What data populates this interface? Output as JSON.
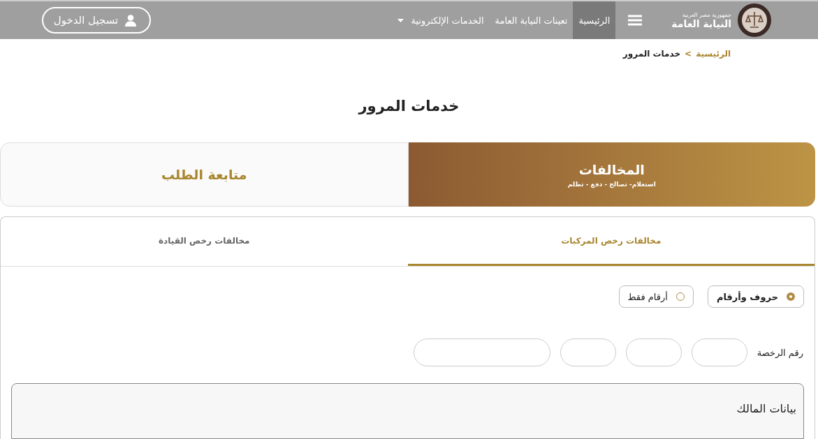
{
  "header": {
    "logo_caption": "جمهورية مصر العربية",
    "logo_title": "النيابة العامة",
    "nav": [
      {
        "label": "الرئيسية",
        "selected": true,
        "dropdown": false
      },
      {
        "label": "تعينات النيابة العامة",
        "selected": false,
        "dropdown": false
      },
      {
        "label": "الخدمات الإلكترونية",
        "selected": false,
        "dropdown": true
      }
    ],
    "login": "تسجيل الدخول"
  },
  "breadcrumb": {
    "items": [
      "الرئيسية",
      ">"
    ],
    "current": "خدمات المرور"
  },
  "page_title": "خدمات المرور",
  "main_tabs": [
    {
      "title": "المخالفات",
      "subtitle": "استعلام- تصالح - دفع - تظلم",
      "selected": true
    },
    {
      "title": "متابعة الطلب",
      "selected": false
    }
  ],
  "sub_tabs": [
    {
      "label": "مخالفات رخص المركبات",
      "selected": true
    },
    {
      "label": "مخالفات رخص القيادة",
      "selected": false
    }
  ],
  "radios": [
    {
      "label": "حروف وأرقام",
      "selected": true
    },
    {
      "label": "أرقام فقط",
      "selected": false
    }
  ],
  "license": {
    "label": "رقم الرخصة",
    "fields": [
      {
        "kind": "small"
      },
      {
        "kind": "small"
      },
      {
        "kind": "small"
      },
      {
        "kind": "wide"
      }
    ]
  },
  "owner": {
    "title": "بيانات المالك"
  }
}
